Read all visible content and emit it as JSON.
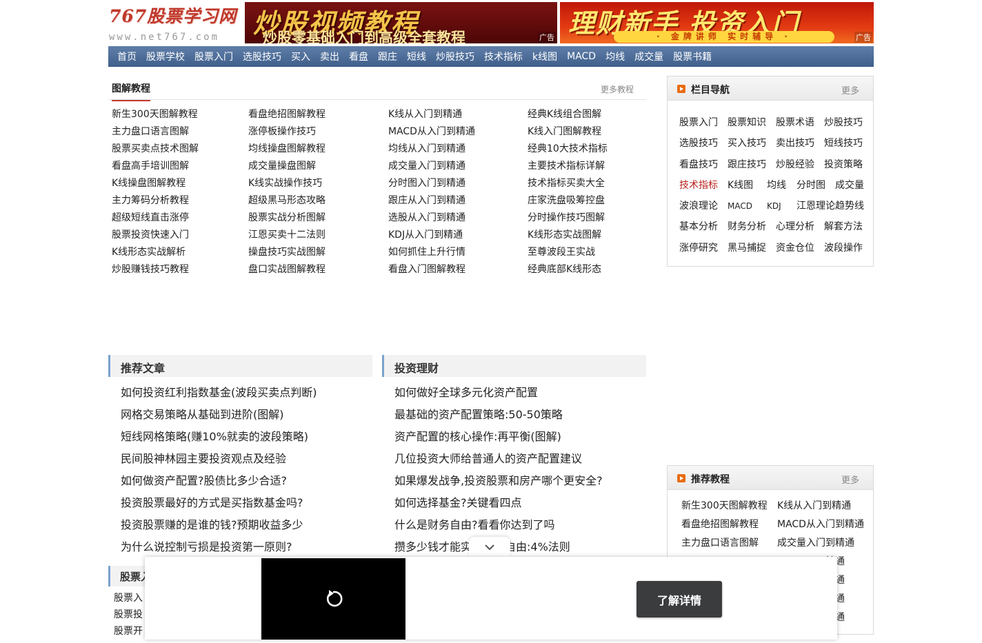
{
  "logo": {
    "title": "767股票学习网",
    "domain": "www.net767.com"
  },
  "ads": [
    {
      "headline": "炒股视频教程",
      "sub": "炒股零基础入门到高级全套教程",
      "tag": "广告"
    },
    {
      "headline": "理财新手 投资入门",
      "sub": "· 金牌讲师 实时辅导 ·",
      "tag": "广告"
    }
  ],
  "nav": [
    "首页",
    "股票学校",
    "股票入门",
    "选股技巧",
    "买入",
    "卖出",
    "看盘",
    "跟庄",
    "短线",
    "炒股技巧",
    "技术指标",
    "k线图",
    "MACD",
    "均线",
    "成交量",
    "股票书籍"
  ],
  "tutorials": {
    "title": "图解教程",
    "more": "更多教程",
    "items": [
      "新生300天图解教程",
      "看盘绝招图解教程",
      "K线从入门到精通",
      "经典K线组合图解",
      "主力盘口语言图解",
      "涨停板操作技巧",
      "MACD从入门到精通",
      "K线入门图解教程",
      "股票买卖点技术图解",
      "均线操盘图解教程",
      "均线从入门到精通",
      "经典10大技术指标",
      "看盘高手培训图解",
      "成交量操盘图解",
      "成交量入门到精通",
      "主要技术指标详解",
      "K线操盘图解教程",
      "K线实战操作技巧",
      "分时图入门到精通",
      "技术指标买卖大全",
      "主力筹码分析教程",
      "超级黑马形态攻略",
      "跟庄从入门到精通",
      "庄家洗盘吸筹控盘",
      "超级短线直击涨停",
      "股票实战分析图解",
      "选股从入门到精通",
      "分时操作技巧图解",
      "股票投资快速入门",
      "江恩买卖十二法则",
      "KDJ从入门到精通",
      "K线形态实战图解",
      "K线形态实战解析",
      "操盘技巧实战图解",
      "如何抓住上升行情",
      "至尊波段王实战",
      "炒股赚钱技巧教程",
      "盘口实战图解教程",
      "看盘入门图解教程",
      "经典底部K线形态"
    ]
  },
  "column_nav": {
    "title": "栏目导航",
    "more": "更多",
    "items": [
      "股票入门",
      "股票知识",
      "股票术语",
      "炒股技巧",
      "选股技巧",
      "买入技巧",
      "卖出技巧",
      "短线技巧",
      "看盘技巧",
      "跟庄技巧",
      "炒股经验",
      "投资策略",
      "技术指标",
      "K线图",
      "均线",
      "分时图",
      "成交量",
      "波浪理论",
      "MACD",
      "KDJ",
      "江恩理论",
      "趋势线",
      "基本分析",
      "财务分析",
      "心理分析",
      "解套方法",
      "涨停研究",
      "黑马捕捉",
      "资金仓位",
      "波段操作"
    ],
    "highlight": "技术指标"
  },
  "recommended": {
    "title": "推荐文章",
    "items": [
      "如何投资红利指数基金(波段买卖点判断)",
      "网格交易策略从基础到进阶(图解)",
      "短线网格策略(赚10%就卖的波段策略)",
      "民间股神林园主要投资观点及经验",
      "如何做资产配置?股债比多少合适?",
      "投资股票最好的方式是买指数基金吗?",
      "投资股票赚的是谁的钱?预期收益多少",
      "为什么说控制亏损是投资第一原则?"
    ]
  },
  "finance": {
    "title": "投资理财",
    "items": [
      "如何做好全球多元化资产配置",
      "最基础的资产配置策略:50-50策略",
      "资产配置的核心操作:再平衡(图解)",
      "几位投资大师给普通人的资产配置建议",
      "如果爆发战争,投资股票和房产哪个更安全?",
      "如何选择基金?关键看四点",
      "什么是财务自由?看看你达到了吗",
      "攒多少钱才能实现财务自由:4%法则"
    ]
  },
  "rec_tutorials": {
    "title": "推荐教程",
    "more": "更多",
    "items": [
      "新生300天图解教程",
      "K线从入门到精通",
      "看盘绝招图解教程",
      "MACD从入门到精通",
      "主力盘口语言图解",
      "成交量入门到精通",
      "",
      "精通",
      "",
      "精通",
      "",
      "精通",
      "",
      "精通"
    ]
  },
  "section3": {
    "title": "股票入",
    "items": [
      "股票入",
      "股票投",
      "股票开"
    ]
  },
  "overlay": {
    "cta": "了解详情"
  }
}
